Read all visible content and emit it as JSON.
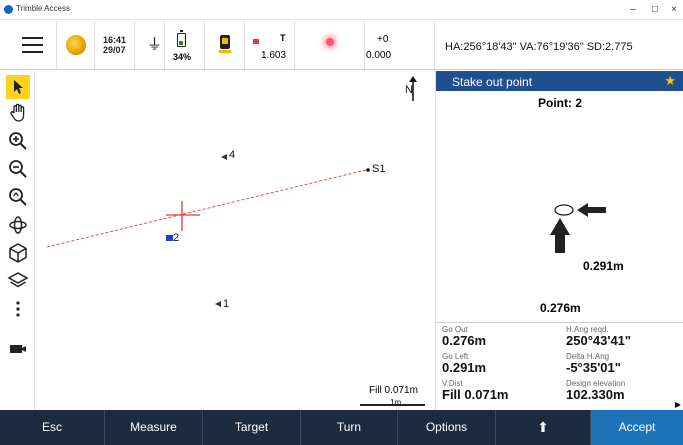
{
  "window": {
    "title": "Trimble Access",
    "minimize": "–",
    "maximize": "□",
    "close": "×"
  },
  "status": {
    "time": "16:41",
    "date": "29/07",
    "battery_pct": "34%",
    "target_label": "T",
    "target_height": "1.603",
    "offset_top": "+0",
    "offset_bottom": "0.000",
    "angles": "HA:256°18'43\"  VA:76°19'36\"  SD:2.775"
  },
  "map": {
    "north": "N",
    "points": [
      {
        "label": "4"
      },
      {
        "label": "S1"
      },
      {
        "label": "2"
      },
      {
        "label": "1"
      }
    ],
    "fill_text": "Fill 0.071m",
    "scale_text": "1m"
  },
  "panel": {
    "title": "Stake out point",
    "point_name": "Point: 2",
    "go_right_value": "0.291m",
    "go_forward_value": "0.276m",
    "deltas": [
      {
        "label": "Go Out",
        "value": "0.276m"
      },
      {
        "label": "H.Ang reqd.",
        "value": "250°43'41\""
      },
      {
        "label": "Go Left",
        "value": "0.291m"
      },
      {
        "label": "Delta H.Ang",
        "value": "-5°35'01\""
      },
      {
        "label": "V.Dist",
        "value": "Fill 0.071m"
      },
      {
        "label": "Design elevation",
        "value": "102.330m"
      }
    ]
  },
  "buttons": {
    "esc": "Esc",
    "measure": "Measure",
    "target": "Target",
    "turn": "Turn",
    "options": "Options",
    "up": "⬆",
    "accept": "Accept"
  },
  "colors": {
    "panel_header": "#1f4f8e",
    "bottom_bar": "#1c2b40",
    "accept": "#1e73b8",
    "active_tool": "#ffd21f",
    "crosshair": "#e53935"
  }
}
